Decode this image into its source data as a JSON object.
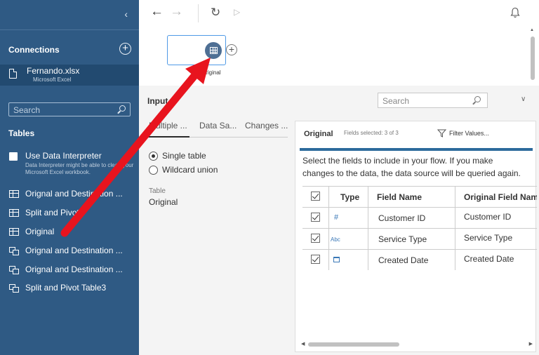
{
  "sidebar": {
    "connections_title": "Connections",
    "file": {
      "name": "Fernando.xlsx",
      "type": "Microsoft Excel"
    },
    "search_placeholder": "Search",
    "tables_title": "Tables",
    "interpreter": {
      "label": "Use Data Interpreter",
      "desc": "Data Interpreter might be able to clean your Microsoft Excel workbook."
    },
    "items": [
      {
        "label": "Orignal and Destination ...",
        "icon": "table-icon"
      },
      {
        "label": "Split and Pivot",
        "icon": "table-icon"
      },
      {
        "label": "Original",
        "icon": "table-icon"
      },
      {
        "label": "Orignal and Destination ...",
        "icon": "union-icon"
      },
      {
        "label": "Orignal and Destination ...",
        "icon": "union-icon"
      },
      {
        "label": "Split and Pivot Table3",
        "icon": "union-icon"
      }
    ]
  },
  "canvas": {
    "node_label": "Original"
  },
  "panel": {
    "title": "Input",
    "search_placeholder": "Search",
    "tabs": [
      "Multiple ...",
      "Data Sa...",
      "Changes ..."
    ],
    "options": [
      "Single table",
      "Wildcard union"
    ],
    "table_caption": "Table",
    "table_value": "Original"
  },
  "card": {
    "title": "Original",
    "fields_selected": "Fields selected: 3 of 3",
    "filter_label": "Filter Values...",
    "description": "Select the fields to include in your flow. If you make changes to the data, the data source will be queried again.",
    "headers": [
      "Type",
      "Field Name",
      "Original Field Name"
    ],
    "rows": [
      {
        "type": "#",
        "field": "Customer ID",
        "original": "Customer ID"
      },
      {
        "type": "Abc",
        "field": "Service Type",
        "original": "Service Type"
      },
      {
        "type": "date",
        "field": "Created Date",
        "original": "Created Date"
      }
    ]
  },
  "colors": {
    "sidebar_bg": "#2f5a84",
    "selected_bg": "#224a70",
    "accent_blue": "#2d6b9c",
    "arrow_red": "#e8141e"
  }
}
